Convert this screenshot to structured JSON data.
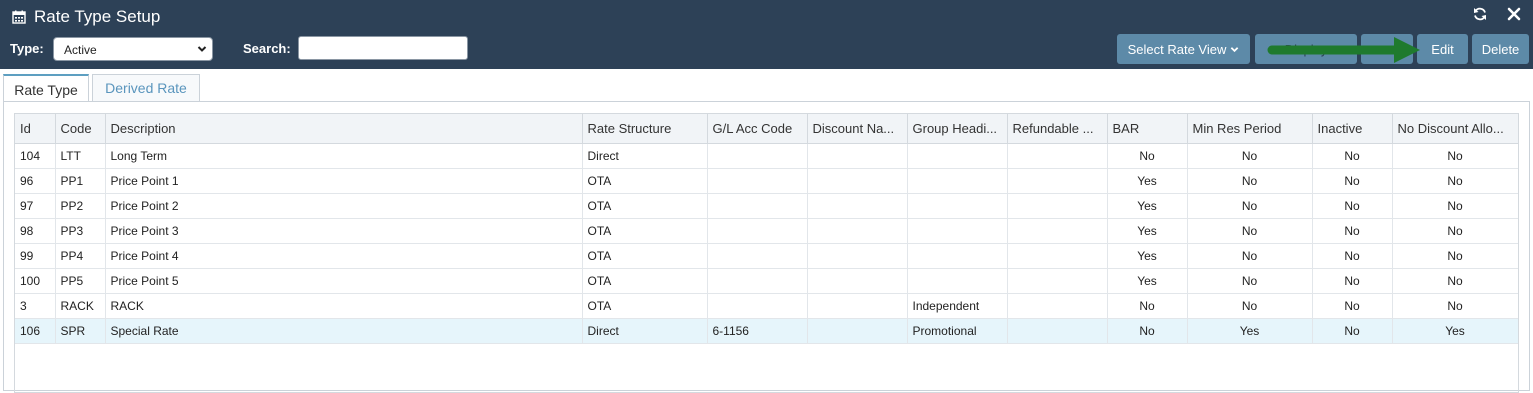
{
  "window": {
    "title": "Rate Type Setup",
    "title_icon": "calendar-icon",
    "refresh_icon": "refresh-icon",
    "close_icon": "close-icon"
  },
  "toolbar": {
    "type_label": "Type:",
    "type_value": "Active",
    "search_label": "Search:",
    "search_value": "",
    "buttons": {
      "select_rate_view": "Select Rate View",
      "display": "Display",
      "copy": "",
      "edit": "Edit",
      "delete": "Delete"
    }
  },
  "tabs": [
    {
      "label": "Rate Type",
      "active": true
    },
    {
      "label": "Derived Rate",
      "active": false
    }
  ],
  "grid": {
    "columns": [
      "Id",
      "Code",
      "Description",
      "Rate Structure",
      "G/L Acc Code",
      "Discount Na...",
      "Group Headi...",
      "Refundable ...",
      "BAR",
      "Min Res Period",
      "Inactive",
      "No Discount Allo..."
    ],
    "rows": [
      [
        "104",
        "LTT",
        "Long Term",
        "Direct",
        "",
        "",
        "",
        "",
        "No",
        "No",
        "No",
        "No"
      ],
      [
        "96",
        "PP1",
        "Price Point 1",
        "OTA",
        "",
        "",
        "",
        "",
        "Yes",
        "No",
        "No",
        "No"
      ],
      [
        "97",
        "PP2",
        "Price Point 2",
        "OTA",
        "",
        "",
        "",
        "",
        "Yes",
        "No",
        "No",
        "No"
      ],
      [
        "98",
        "PP3",
        "Price Point 3",
        "OTA",
        "",
        "",
        "",
        "",
        "Yes",
        "No",
        "No",
        "No"
      ],
      [
        "99",
        "PP4",
        "Price Point 4",
        "OTA",
        "",
        "",
        "",
        "",
        "Yes",
        "No",
        "No",
        "No"
      ],
      [
        "100",
        "PP5",
        "Price Point 5",
        "OTA",
        "",
        "",
        "",
        "",
        "Yes",
        "No",
        "No",
        "No"
      ],
      [
        "3",
        "RACK",
        "RACK",
        "OTA",
        "",
        "",
        "Independent",
        "",
        "No",
        "No",
        "No",
        "No"
      ],
      [
        "106",
        "SPR",
        "Special Rate",
        "Direct",
        "6-1156",
        "",
        "Promotional",
        "",
        "No",
        "Yes",
        "No",
        "Yes"
      ]
    ],
    "selected_row": 7
  },
  "annotation": {
    "arrow_color": "#1f7a2e",
    "selected_row_color": "#e6f5fb"
  }
}
